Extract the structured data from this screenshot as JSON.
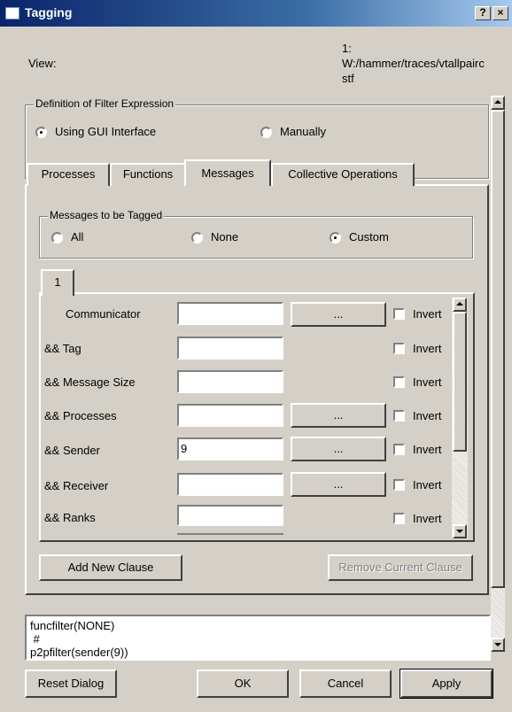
{
  "window": {
    "title": "Tagging",
    "help_glyph": "?",
    "close_glyph": "×"
  },
  "view": {
    "label": "View:",
    "value": "1:\nW:/hammer/traces/vtallpairc\nstf"
  },
  "definition": {
    "legend": "Definition of Filter Expression",
    "options": [
      {
        "label": "Using GUI Interface",
        "selected": true
      },
      {
        "label": "Manually",
        "selected": false
      }
    ]
  },
  "tabs": [
    {
      "label": "Processes",
      "active": false
    },
    {
      "label": "Functions",
      "active": false
    },
    {
      "label": "Messages",
      "active": true
    },
    {
      "label": "Collective Operations",
      "active": false
    }
  ],
  "messages_tagged": {
    "legend": "Messages to be Tagged",
    "options": [
      {
        "label": "All",
        "selected": false
      },
      {
        "label": "None",
        "selected": false
      },
      {
        "label": "Custom",
        "selected": true
      }
    ]
  },
  "clause_tabs": [
    {
      "label": "1"
    }
  ],
  "clauses": [
    {
      "label": "Communicator",
      "value": "",
      "has_browse": true,
      "invert_label": "Invert",
      "invert": false
    },
    {
      "label": "&& Tag",
      "value": "",
      "has_browse": false,
      "invert_label": "Invert",
      "invert": false
    },
    {
      "label": "&& Message Size",
      "value": "",
      "has_browse": false,
      "invert_label": "Invert",
      "invert": false
    },
    {
      "label": "&& Processes",
      "value": "",
      "has_browse": true,
      "invert_label": "Invert",
      "invert": false
    },
    {
      "label": "&& Sender",
      "value": "9",
      "has_browse": true,
      "invert_label": "Invert",
      "invert": false
    },
    {
      "label": "&& Receiver",
      "value": "",
      "has_browse": true,
      "invert_label": "Invert",
      "invert": false
    },
    {
      "label": "&& Ranks",
      "value": "",
      "has_browse": false,
      "invert_label": "Invert",
      "invert": false
    }
  ],
  "browse_label": "...",
  "buttons": {
    "add_clause": "Add New Clause",
    "remove_clause": "Remove Current Clause",
    "reset": "Reset Dialog",
    "ok": "OK",
    "cancel": "Cancel",
    "apply": "Apply"
  },
  "expression_lines": [
    "funcfilter(NONE)",
    " #",
    "p2pfilter(sender(9))"
  ]
}
